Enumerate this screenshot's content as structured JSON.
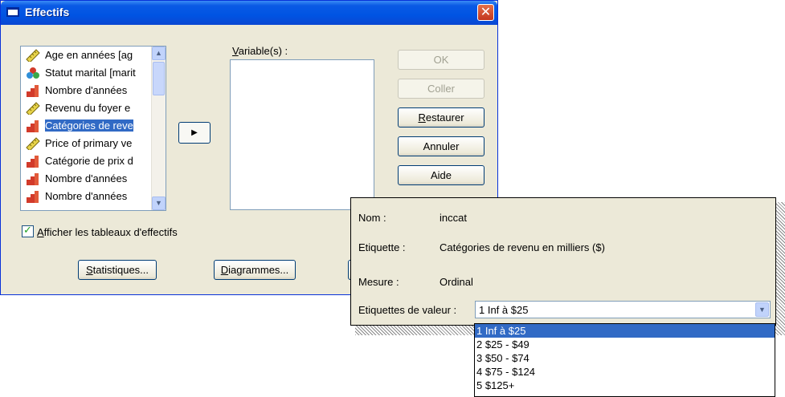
{
  "window": {
    "title": "Effectifs",
    "close_glyph": "✕",
    "icon": "window-icon"
  },
  "source_list": {
    "items": [
      {
        "label": "Age en années [ag",
        "icon": "ruler-icon"
      },
      {
        "label": "Statut marital [marit",
        "icon": "nominal-icon"
      },
      {
        "label": "Nombre d'années ",
        "icon": "ordinal-icon"
      },
      {
        "label": "Revenu du foyer e",
        "icon": "ruler-icon"
      },
      {
        "label": "Catégories de reve",
        "icon": "ordinal-icon",
        "selected": true
      },
      {
        "label": "Price of primary ve",
        "icon": "ruler-icon"
      },
      {
        "label": "Catégorie de prix d",
        "icon": "ordinal-icon"
      },
      {
        "label": "Nombre d'années ",
        "icon": "ordinal-icon"
      },
      {
        "label": "Nombre d'années",
        "icon": "ordinal-icon"
      }
    ]
  },
  "move_button": {
    "glyph": "▶"
  },
  "target": {
    "label_u": "V",
    "label_rest": "ariable(s) :"
  },
  "buttons": {
    "ok": "OK",
    "paste": "Coller",
    "reset_u": "R",
    "reset_rest": "estaurer",
    "cancel": "Annuler",
    "help": "Aide",
    "statistics_u": "S",
    "statistics_rest": "tatistiques...",
    "charts_u": "D",
    "charts_rest": "iagrammes..."
  },
  "checkbox": {
    "label_u": "A",
    "label_rest": "fficher les tableaux d'effectifs",
    "checked": true
  },
  "info": {
    "name_key": "Nom :",
    "name_val": "inccat",
    "label_key": "Etiquette :",
    "label_val": "Catégories de revenu en milliers ($)",
    "measure_key": "Mesure :",
    "measure_val": "Ordinal",
    "value_labels_key": "Etiquettes de valeur :",
    "value_labels_selected": "1 Inf à $25"
  },
  "value_labels": [
    "1 Inf à $25",
    "2 $25 - $49",
    "3 $50 - $74",
    "4 $75 - $124",
    "5 $125+"
  ],
  "colors": {
    "title_blue": "#0054e3",
    "selection": "#316ac5",
    "dialog_bg": "#ece9d8"
  }
}
